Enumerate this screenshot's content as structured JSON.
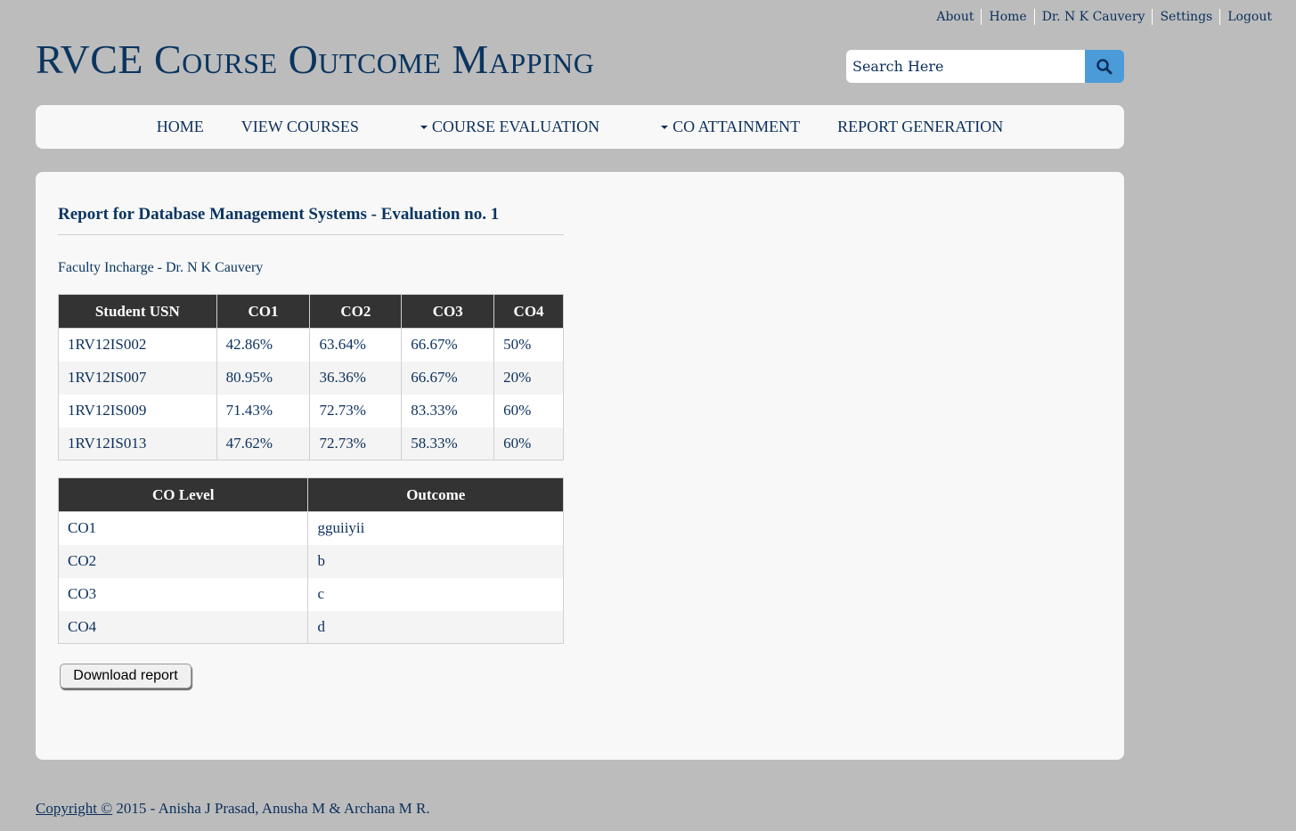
{
  "top_links": [
    "About",
    "Home",
    "Dr. N K Cauvery",
    "Settings",
    "Logout"
  ],
  "site_title": "RVCE Course Outcome Mapping",
  "search": {
    "placeholder": "Search Here",
    "icon": "search-icon",
    "button_color": "#4a9bd8"
  },
  "nav": {
    "home": "HOME",
    "view_courses": "VIEW COURSES",
    "course_evaluation": "COURSE EVALUATION",
    "co_attainment": "CO ATTAINMENT",
    "report_generation": "REPORT GENERATION"
  },
  "report": {
    "heading": "Report for Database Management Systems - Evaluation no. 1",
    "faculty": "Faculty Incharge - Dr. N K Cauvery",
    "scores_table": {
      "headers": [
        "Student USN",
        "CO1",
        "CO2",
        "CO3",
        "CO4"
      ],
      "rows": [
        [
          "1RV12IS002",
          "42.86%",
          "63.64%",
          "66.67%",
          "50%"
        ],
        [
          "1RV12IS007",
          "80.95%",
          "36.36%",
          "66.67%",
          "20%"
        ],
        [
          "1RV12IS009",
          "71.43%",
          "72.73%",
          "83.33%",
          "60%"
        ],
        [
          "1RV12IS013",
          "47.62%",
          "72.73%",
          "58.33%",
          "60%"
        ]
      ]
    },
    "outcome_table": {
      "headers": [
        "CO Level",
        "Outcome"
      ],
      "rows": [
        [
          "CO1",
          "gguiiyii"
        ],
        [
          "CO2",
          "b"
        ],
        [
          "CO3",
          "c"
        ],
        [
          "CO4",
          "d"
        ]
      ]
    },
    "download_label": "Download report"
  },
  "footer": {
    "copyright_link": "Copyright ©",
    "text": " 2015 - Anisha J Prasad, Anusha M & Archana M R."
  }
}
